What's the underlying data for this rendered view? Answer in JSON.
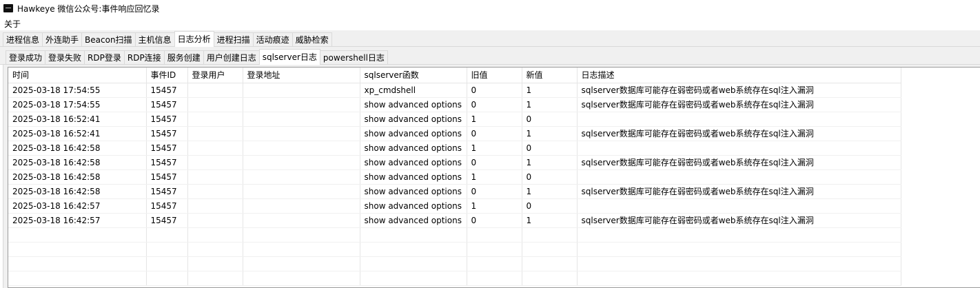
{
  "window": {
    "title": "Hawkeye 微信公众号:事件响应回忆录",
    "icon": "app-icon"
  },
  "menu": {
    "items": [
      "关于"
    ]
  },
  "tabs": {
    "main": [
      "进程信息",
      "外连助手",
      "Beacon扫描",
      "主机信息",
      "日志分析",
      "进程扫描",
      "活动痕迹",
      "威胁检索"
    ],
    "main_active": "日志分析",
    "sub": [
      "登录成功",
      "登录失败",
      "RDP登录",
      "RDP连接",
      "服务创建",
      "用户创建日志",
      "sqlserver日志",
      "powershell日志"
    ],
    "sub_active": "sqlserver日志"
  },
  "table": {
    "columns": [
      "时间",
      "事件ID",
      "登录用户",
      "登录地址",
      "sqlserver函数",
      "旧值",
      "新值",
      "日志描述"
    ],
    "rows": [
      [
        "2025-03-18 17:54:55",
        "15457",
        "",
        "",
        "xp_cmdshell",
        "0",
        "1",
        "sqlserver数据库可能存在弱密码或者web系统存在sql注入漏洞"
      ],
      [
        "2025-03-18 17:54:55",
        "15457",
        "",
        "",
        "show advanced options",
        "0",
        "1",
        "sqlserver数据库可能存在弱密码或者web系统存在sql注入漏洞"
      ],
      [
        "2025-03-18 16:52:41",
        "15457",
        "",
        "",
        "show advanced options",
        "1",
        "0",
        ""
      ],
      [
        "2025-03-18 16:52:41",
        "15457",
        "",
        "",
        "show advanced options",
        "0",
        "1",
        "sqlserver数据库可能存在弱密码或者web系统存在sql注入漏洞"
      ],
      [
        "2025-03-18 16:42:58",
        "15457",
        "",
        "",
        "show advanced options",
        "1",
        "0",
        ""
      ],
      [
        "2025-03-18 16:42:58",
        "15457",
        "",
        "",
        "show advanced options",
        "0",
        "1",
        "sqlserver数据库可能存在弱密码或者web系统存在sql注入漏洞"
      ],
      [
        "2025-03-18 16:42:58",
        "15457",
        "",
        "",
        "show advanced options",
        "1",
        "0",
        ""
      ],
      [
        "2025-03-18 16:42:58",
        "15457",
        "",
        "",
        "show advanced options",
        "0",
        "1",
        "sqlserver数据库可能存在弱密码或者web系统存在sql注入漏洞"
      ],
      [
        "2025-03-18 16:42:57",
        "15457",
        "",
        "",
        "show advanced options",
        "1",
        "0",
        ""
      ],
      [
        "2025-03-18 16:42:57",
        "15457",
        "",
        "",
        "show advanced options",
        "0",
        "1",
        "sqlserver数据库可能存在弱密码或者web系统存在sql注入漏洞"
      ]
    ]
  },
  "colors": {
    "tab_background": "#f0f0f0",
    "active_tab": "#ffffff",
    "grid_border": "#9a9a9a"
  }
}
